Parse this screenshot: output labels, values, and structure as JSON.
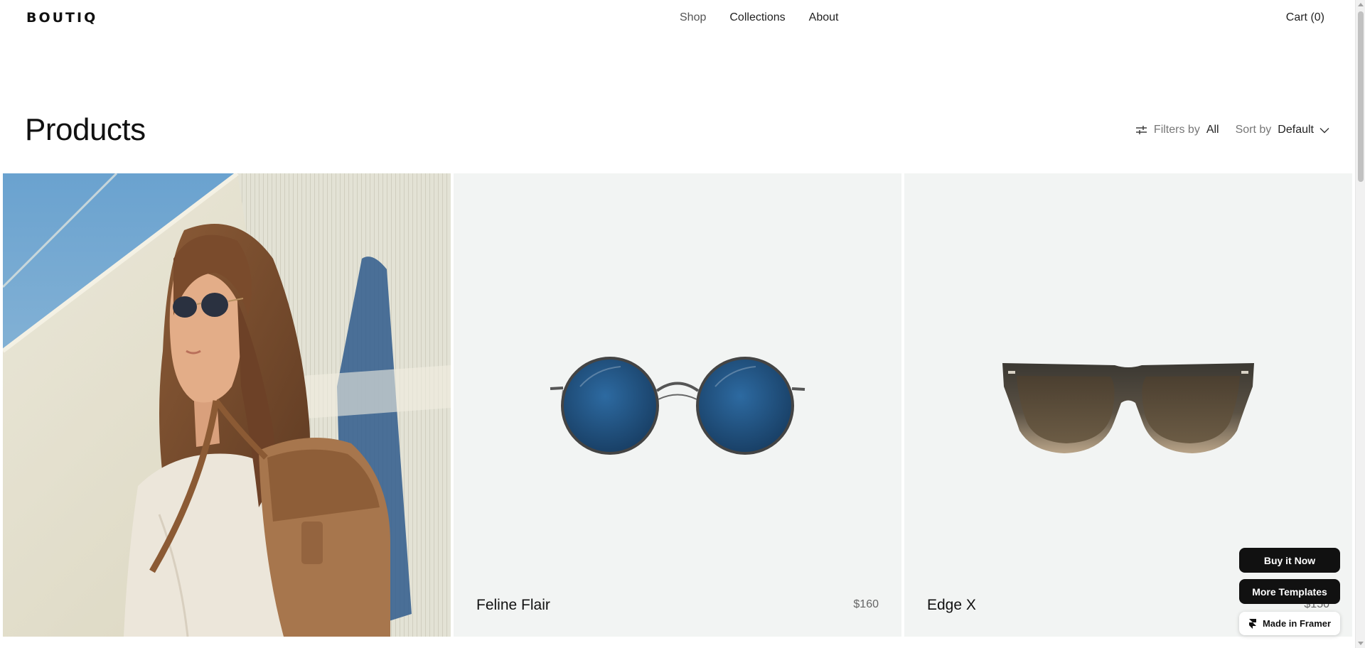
{
  "header": {
    "logo": "BOUTIQ",
    "nav": [
      "Shop",
      "Collections",
      "About"
    ],
    "cart": "Cart (0)"
  },
  "page": {
    "title": "Products",
    "filters_label": "Filters by",
    "filters_value": "All",
    "sort_label": "Sort by",
    "sort_value": "Default"
  },
  "products": [
    {
      "name": "Feline Flair",
      "price": "$160"
    },
    {
      "name": "Edge X",
      "price": "$150"
    }
  ],
  "floating": {
    "buy_now": "Buy it Now",
    "more_templates": "More Templates",
    "made_in_framer": "Made in Framer"
  },
  "icons": {
    "filter": "sliders-icon",
    "chevron": "chevron-down-icon",
    "framer": "framer-logo-icon"
  },
  "colors": {
    "tile_bg": "#f2f4f3",
    "button_bg": "#111111",
    "lens_blue": "#1f4a75",
    "lens_brown": "#5a4a36"
  }
}
